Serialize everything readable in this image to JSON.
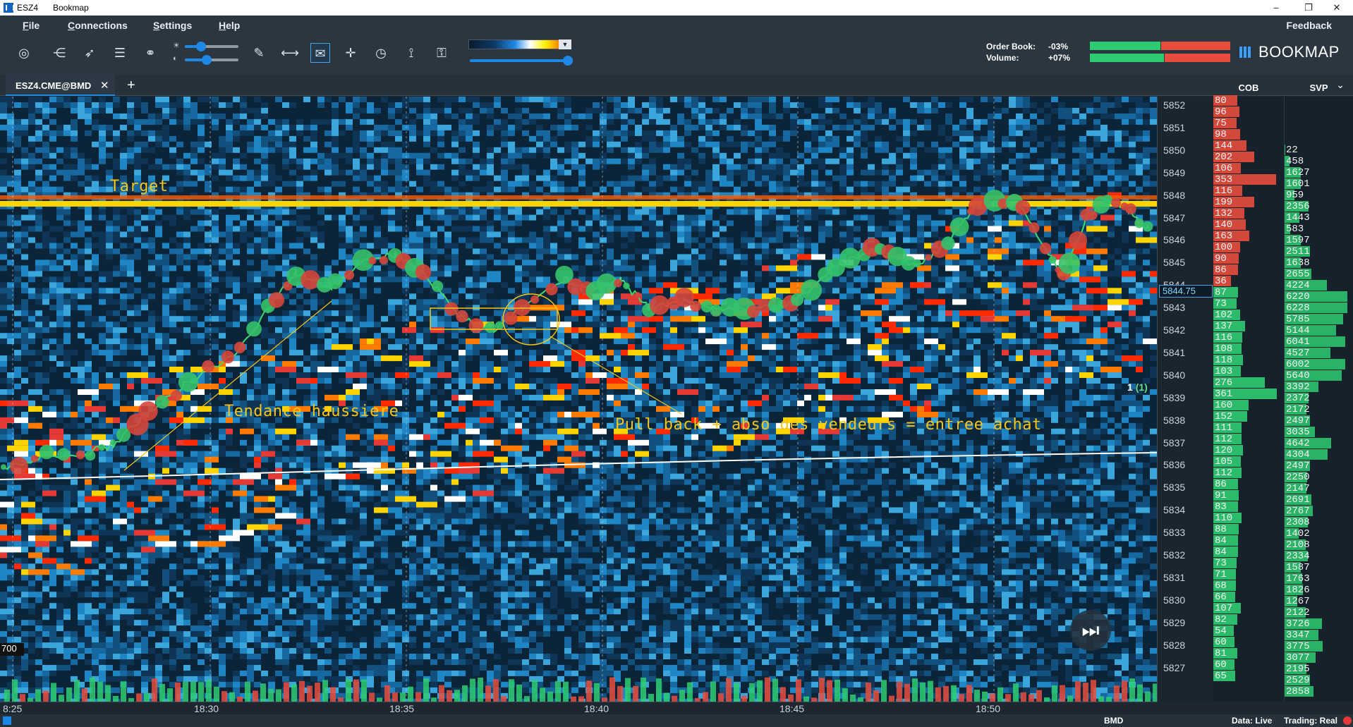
{
  "window": {
    "instrument_title": "ESZ4",
    "app_title": "Bookmap",
    "minimize": "–",
    "maximize": "❐",
    "close": "✕"
  },
  "menu": {
    "file": "File",
    "connections": "Connections",
    "settings": "Settings",
    "help": "Help",
    "feedback": "Feedback"
  },
  "toolbar": {
    "stats": {
      "order_book_label": "Order Book:",
      "order_book_value": "-03%",
      "volume_label": "Volume:",
      "volume_value": "+07%"
    },
    "logo_text": "BOOKMAP",
    "icons": [
      "camera-icon",
      "share-icon",
      "rocket-icon",
      "layers-icon",
      "link-icon",
      "pencil-icon",
      "ruler-icon",
      "chat-icon",
      "crosshair-icon",
      "timer-icon",
      "indicator-icon",
      "lock-icon"
    ]
  },
  "tabs": [
    {
      "label": "ESZ4.CME@BMD",
      "close": "✕"
    }
  ],
  "add_tab": "+",
  "collapse": "⌄",
  "price_axis": [
    "5852",
    "5851",
    "5850",
    "5849",
    "5848",
    "5847",
    "5846",
    "5845",
    "5844",
    "5843",
    "5842",
    "5841",
    "5840",
    "5839",
    "5838",
    "5837",
    "5836",
    "5835",
    "5834",
    "5833",
    "5832",
    "5831",
    "5830",
    "5829",
    "5828",
    "5827"
  ],
  "current_price": "5844.75",
  "trade_marker": {
    "qty": "1",
    "count": "(1)"
  },
  "columns": {
    "cob": "COB",
    "svp": "SVP"
  },
  "cob_values": [
    "80",
    "96",
    "75",
    "98",
    "144",
    "202",
    "106",
    "353",
    "116",
    "199",
    "132",
    "140",
    "163",
    "100",
    "90",
    "86",
    "36",
    "87",
    "73",
    "102",
    "137",
    "116",
    "108",
    "118",
    "103",
    "276",
    "361",
    "160",
    "152",
    "111",
    "112",
    "120",
    "105",
    "112",
    "86",
    "91",
    "83",
    "110",
    "88",
    "84",
    "84",
    "73",
    "71",
    "68",
    "66",
    "107",
    "82",
    "54",
    "60",
    "81",
    "60",
    "65"
  ],
  "svp_values": [
    "22",
    "458",
    "1627",
    "1601",
    "959",
    "2356",
    "1443",
    "583",
    "1597",
    "2511",
    "1638",
    "2655",
    "4224",
    "6220",
    "6228",
    "5785",
    "5144",
    "6041",
    "4527",
    "6002",
    "5640",
    "3392",
    "2372",
    "2172",
    "2497",
    "3035",
    "4642",
    "4304",
    "2497",
    "2250",
    "2147",
    "2691",
    "2767",
    "2308",
    "1402",
    "2108",
    "2334",
    "1587",
    "1763",
    "1826",
    "1267",
    "2122",
    "3726",
    "3347",
    "3775",
    "3077",
    "2195",
    "2529",
    "2858"
  ],
  "time_axis": [
    "8:25",
    "18:30",
    "18:35",
    "18:40",
    "18:45",
    "18:50"
  ],
  "annotations": {
    "target": "Target",
    "trend": "Tendance haussiere",
    "entry": "Pull back + abso des vendeurs = entree achat"
  },
  "left_label": "700",
  "status": {
    "feed": "BMD",
    "data": "Data: Live",
    "trading": "Trading: Real"
  },
  "colors": {
    "buy": "#2ecc71",
    "sell": "#e74c3c",
    "accent": "#1e88e5",
    "annotation": "#f5c518"
  }
}
